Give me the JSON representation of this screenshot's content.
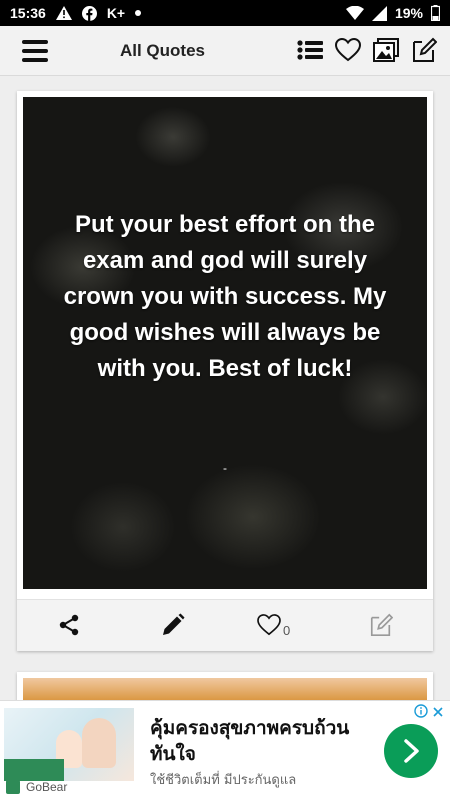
{
  "status_bar": {
    "time": "15:36",
    "carrier_badge": "K+",
    "battery": "19%"
  },
  "app_bar": {
    "title": "All Quotes"
  },
  "quote_card": {
    "text": "Put your best effort on the exam and god will surely crown you with success. My good wishes will always be with you. Best of luck!",
    "author": "-",
    "like_count": "0"
  },
  "ad": {
    "title": "คุ้มครองสุขภาพครบถ้วน ทันใจ",
    "subtitle": "ใช้ชีวิตเต็มที่ มีประกันดูแล",
    "brand": "GoBear"
  },
  "colors": {
    "ad_button": "#0a9d58",
    "app_bar_bg": "#f2f2f2"
  }
}
